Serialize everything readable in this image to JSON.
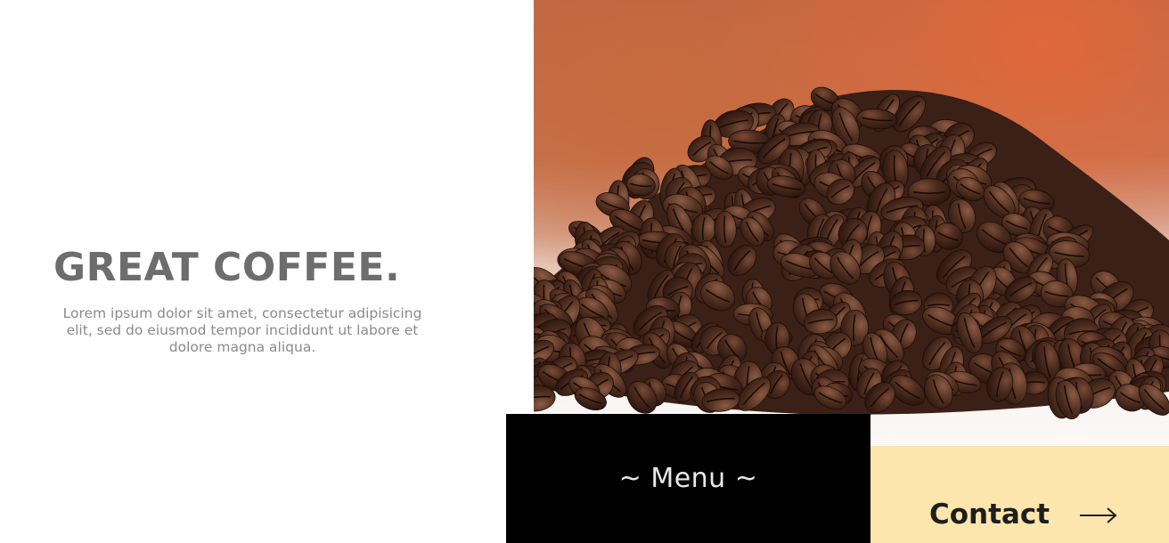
{
  "hero": {
    "title": "GREAT COFFEE.",
    "description": "Lorem ipsum dolor sit amet, consectetur adipisicing elit, sed do eiusmod tempor incididunt ut labore et dolore magna aliqua."
  },
  "photo": {
    "alt": "coffee-beans-photo"
  },
  "tiles": {
    "menu_label": "~ Menu ~",
    "contact_label": "Contact",
    "contact_icon": "arrow-right-icon"
  },
  "colors": {
    "menu_bg": "#000000",
    "contact_bg": "#fde6ad",
    "title_text": "#6d6d6d"
  }
}
